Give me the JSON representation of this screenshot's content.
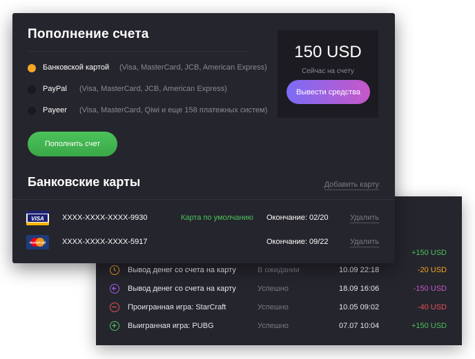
{
  "deposit": {
    "title": "Пополнение счета",
    "methods": [
      {
        "name": "Банковской картой",
        "desc": "(Visa, MasterCard, JCB, American Express)",
        "selected": true
      },
      {
        "name": "PayPal",
        "desc": "(Visa, MasterCard, JCB, American Express)",
        "selected": false
      },
      {
        "name": "Payeer",
        "desc": "(Visa, MasterCard, Qiwi и еще 158 платежных систем)",
        "selected": false
      }
    ],
    "deposit_button": "Пополнить счет"
  },
  "balance": {
    "amount": "150 USD",
    "label": "Сейчас на счету",
    "withdraw_button": "Вывести средства"
  },
  "cards": {
    "title": "Банковские карты",
    "add_link": "Добавить карту",
    "items": [
      {
        "brand": "visa-logo",
        "number": "XXXX-XXXX-XXXX-9930",
        "default_label": "Карта по умолчанию",
        "expiry": "Окончание: 02/20",
        "delete": "Удалить"
      },
      {
        "brand": "mastercard-logo",
        "number": "XXXX-XXXX-XXXX-5917",
        "default_label": "",
        "expiry": "Окончание: 09/22",
        "delete": "Удалить"
      }
    ]
  },
  "transactions": [
    {
      "name": "",
      "status": "",
      "date": "",
      "amount": "+150 USD",
      "amount_color": "#4cc25a",
      "icon": "plus-circle-icon"
    },
    {
      "name": "Вывод денег со счета на карту",
      "status": "В ожидании",
      "date": "10.09  22:18",
      "amount": "-20 USD",
      "amount_color": "#f5a623",
      "icon": "clock-icon",
      "icon_color": "#f5a623"
    },
    {
      "name": "Вывод денег со счета на карту",
      "status": "Успешно",
      "date": "18.09  16:06",
      "amount": "-150 USD",
      "amount_color": "#c757c8",
      "icon": "arrow-left-icon",
      "icon_color": "#a25ee0"
    },
    {
      "name": "Проигранная игра: StarCraft",
      "status": "Успешно",
      "date": "10.05  09:02",
      "amount": "-40 USD",
      "amount_color": "#e8505b",
      "icon": "minus-circle-icon",
      "icon_color": "#e8505b"
    },
    {
      "name": "Выигранная игра: PUBG",
      "status": "Успешно",
      "date": "07.07  10:04",
      "amount": "+150 USD",
      "amount_color": "#4cc25a",
      "icon": "plus-circle-icon",
      "icon_color": "#4cc25a"
    }
  ]
}
